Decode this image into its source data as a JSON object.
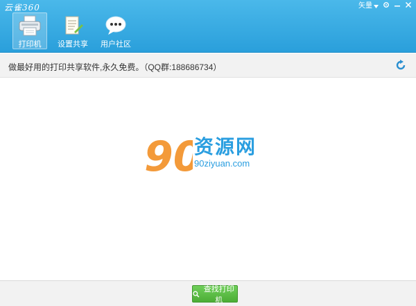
{
  "app": {
    "logo_text": "云雀360"
  },
  "window_controls": {
    "skin_label": "矢量"
  },
  "tabs": [
    {
      "label": "打印机",
      "icon": "printer-icon",
      "active": true
    },
    {
      "label": "设置共享",
      "icon": "share-settings-icon",
      "active": false
    },
    {
      "label": "用户社区",
      "icon": "chat-bubble-icon",
      "active": false
    }
  ],
  "infobar": {
    "slogan": "做最好用的打印共享软件,永久免费。（QQ群:188686734）"
  },
  "watermark": {
    "brand_number": "90",
    "brand_text": "资源网",
    "url": "90ziyuan.com"
  },
  "footer": {
    "find_button_label": "查找打印机"
  },
  "colors": {
    "header": "#2a9fdb",
    "accent": "#4cad36",
    "watermark": "#2a9ee0"
  }
}
